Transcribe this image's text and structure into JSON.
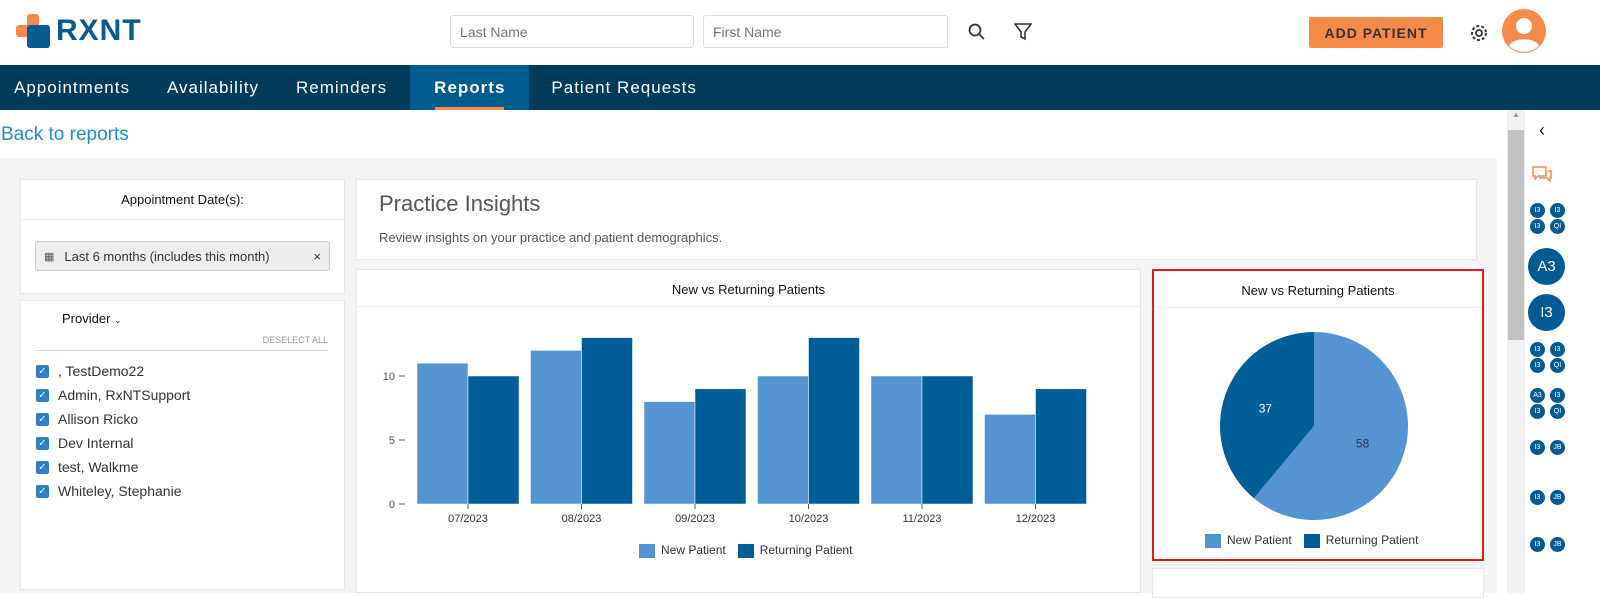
{
  "header": {
    "brand": "RXNT",
    "last_name_placeholder": "Last Name",
    "first_name_placeholder": "First Name",
    "add_patient": "ADD PATIENT"
  },
  "nav": [
    "Appointments",
    "Availability",
    "Reminders",
    "Reports",
    "Patient Requests"
  ],
  "back_link": "Back to reports",
  "filters": {
    "date_label": "Appointment Date(s):",
    "date_value": "Last 6 months (includes this month)",
    "provider_label": "Provider",
    "deselect_all": "DESELECT ALL",
    "providers": [
      ", TestDemo22",
      "Admin, RxNTSupport",
      "Allison Ricko",
      "Dev Internal",
      "test, Walkme",
      "Whiteley, Stephanie"
    ]
  },
  "insights": {
    "title": "Practice Insights",
    "subtitle": "Review insights on your practice and patient demographics."
  },
  "colors": {
    "new": "#5594d2",
    "returning": "#005e99",
    "accent": "#f58a4b",
    "nav": "#003b5c"
  },
  "chart_data": [
    {
      "type": "bar",
      "title": "New vs Returning Patients",
      "categories": [
        "07/2023",
        "08/2023",
        "09/2023",
        "10/2023",
        "11/2023",
        "12/2023"
      ],
      "series": [
        {
          "name": "New Patient",
          "values": [
            11,
            12,
            8,
            10,
            10,
            7
          ]
        },
        {
          "name": "Returning Patient",
          "values": [
            10,
            13,
            9,
            13,
            10,
            9
          ]
        }
      ],
      "yticks": [
        "0",
        "5",
        "10"
      ],
      "ylim": [
        0,
        13
      ],
      "legend": "bottom"
    },
    {
      "type": "pie",
      "title": "New vs Returning Patients",
      "labels": [
        "New Patient",
        "Returning Patient"
      ],
      "values": [
        58,
        37
      ],
      "value_labels": [
        "58",
        "37"
      ],
      "legend": "bottom"
    }
  ],
  "right_rail": {
    "large_avatars": [
      "A3",
      "I3"
    ],
    "groups": [
      [
        "I3",
        "I3",
        "I3",
        "QI"
      ],
      [
        "I3",
        "I3",
        "I3",
        "QI"
      ],
      [
        "A3",
        "I3",
        "I3",
        "QI"
      ],
      [
        "I3",
        "JB"
      ],
      [
        "I3",
        "JB"
      ],
      [
        "I3",
        "JB"
      ]
    ]
  }
}
